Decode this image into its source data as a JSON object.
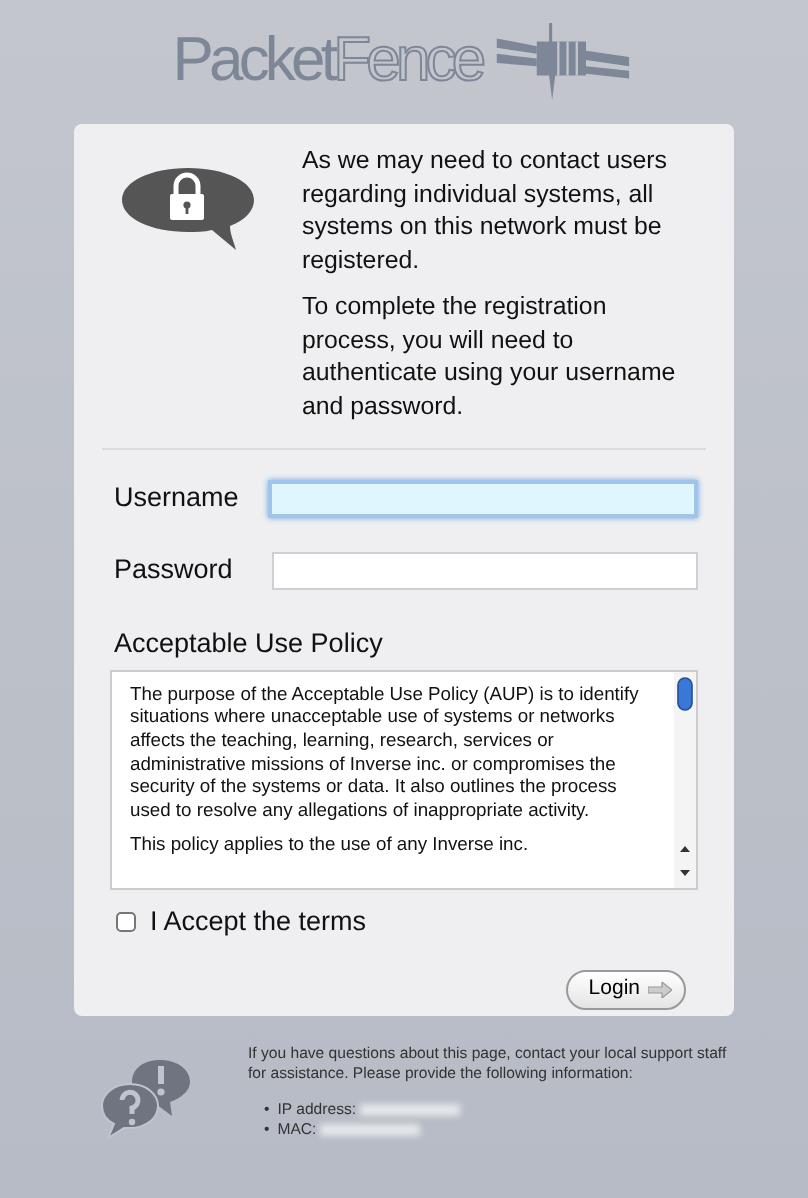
{
  "logo": {
    "part_1": "Packet",
    "part_2": "Fence"
  },
  "intro": [
    "As we may need to contact users regarding individual systems, all systems on this network must be registered.",
    "To complete the registration process, you will need to authenticate using your username and password."
  ],
  "fields": [
    {
      "label": "Username",
      "focused": true
    },
    {
      "label": "Password",
      "focused": false
    }
  ],
  "aup": {
    "title": "Acceptable Use Policy",
    "paragraphs": [
      "The purpose of the Acceptable Use Policy (AUP) is to identify situations where unacceptable use of systems or networks affects the teaching, learning, research, services or administrative missions of Inverse inc. or compromises the security of the systems or data. It also outlines the process used to resolve any allegations of inappropriate activity.",
      "This policy applies to the use of any Inverse inc."
    ]
  },
  "accept": {
    "label": "I Accept the terms",
    "checked": false
  },
  "login_button": {
    "label": "Login"
  },
  "footer": {
    "text": "If you have questions about this page, contact your local support staff for assistance. Please provide the following information:",
    "items": [
      {
        "bullet": "•",
        "label": "IP address:"
      },
      {
        "bullet": "•",
        "label": "MAC:"
      }
    ]
  }
}
